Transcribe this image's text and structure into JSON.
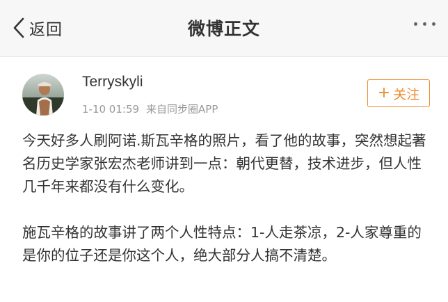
{
  "navbar": {
    "back_label": "返回",
    "title": "微博正文"
  },
  "post": {
    "username": "Terryskyli",
    "time": "1-10 01:59",
    "source": "来自同步圈APP",
    "follow_plus": "+",
    "follow_label": "关注",
    "paragraph1": "今天好多人刷阿诺.斯瓦辛格的照片，看了他的故事，突然想起著名历史学家张宏杰老师讲到一点：朝代更替，技术进步，但人性几千年来都没有什么变化。",
    "paragraph2": "施瓦辛格的故事讲了两个人性特点：1-人走茶凉，2-人家尊重的是你的位子还是你这个人，绝大部分人搞不清楚。"
  },
  "colors": {
    "accent": "#f08a2e",
    "navbar_bg": "#f7f7f7",
    "meta_text": "#999999"
  },
  "icons": {
    "back": "chevron-left-icon",
    "more": "more-dots-icon",
    "avatar": "avatar"
  }
}
